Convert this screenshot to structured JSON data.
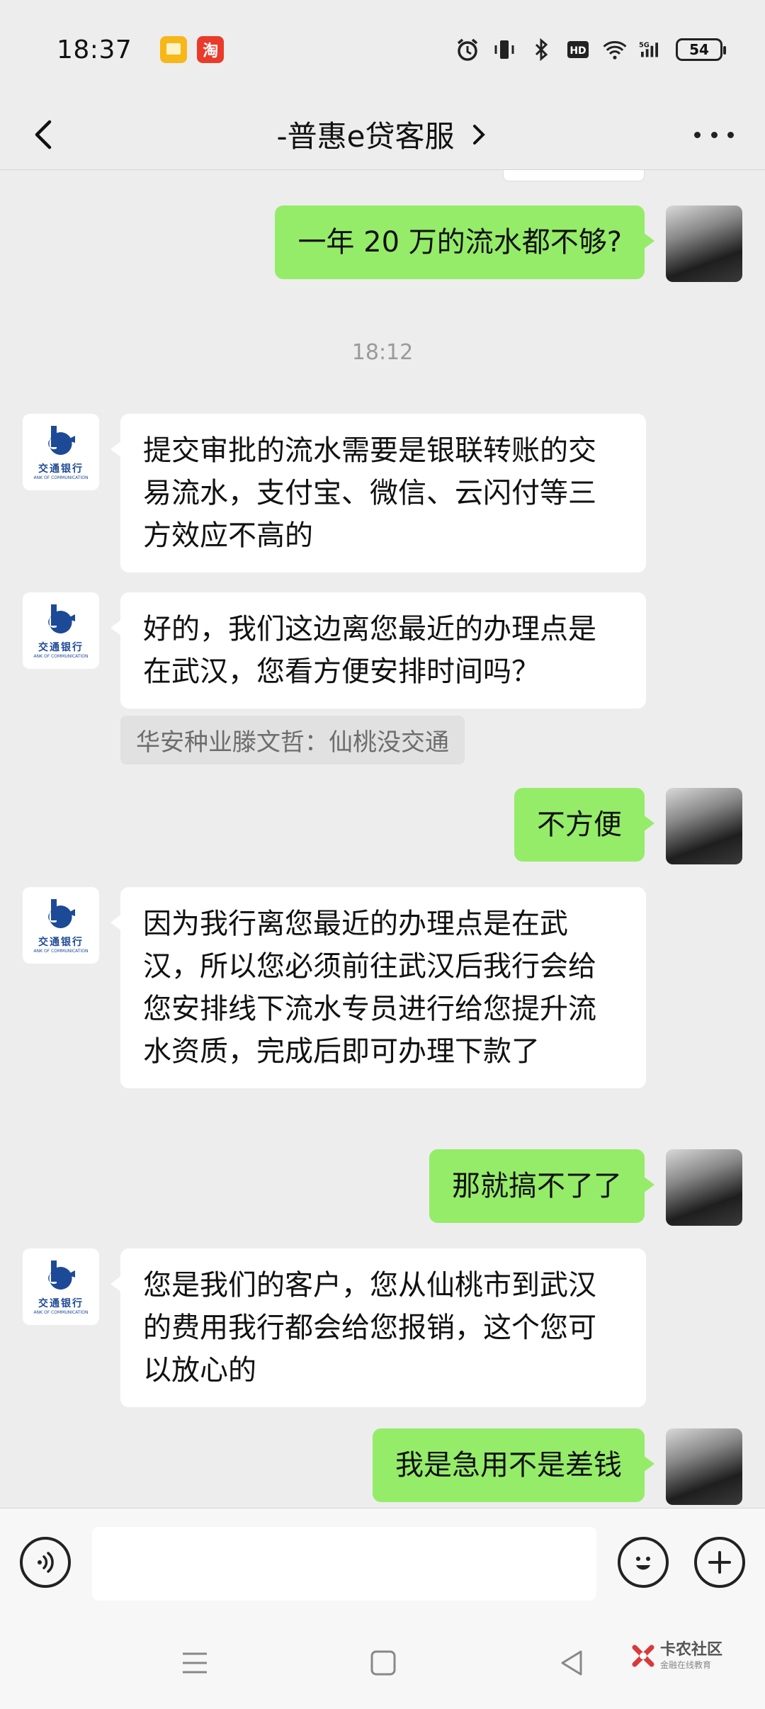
{
  "status_bar": {
    "time": "18:37",
    "notif_taobao": "淘",
    "battery": "54"
  },
  "header": {
    "title": "-普惠e贷客服"
  },
  "bank_logo": {
    "name_cn": "交通银行",
    "name_en": "ANK OF COMMUNICATION"
  },
  "messages": [
    {
      "from": "me",
      "text": "一年 20 万的流水都不够?"
    },
    {
      "type": "time",
      "text": "18:12"
    },
    {
      "from": "bank",
      "text": "提交审批的流水需要是银联转账的交易流水，支付宝、微信、云闪付等三方效应不高的"
    },
    {
      "from": "bank",
      "text": "好的，我们这边离您最近的办理点是在武汉，您看方便安排时间吗？"
    },
    {
      "type": "quote",
      "text": "华安种业滕文哲：仙桃没交通"
    },
    {
      "from": "me",
      "text": "不方便"
    },
    {
      "from": "bank",
      "text": "因为我行离您最近的办理点是在武汉，所以您必须前往武汉后我行会给您安排线下流水专员进行给您提升流水资质，完成后即可办理下款了"
    },
    {
      "from": "me",
      "text": "那就搞不了了"
    },
    {
      "from": "bank",
      "text": "您是我们的客户，您从仙桃市到武汉的费用我行都会给您报销，这个您可以放心的"
    },
    {
      "from": "me",
      "text": "我是急用不是差钱"
    }
  ],
  "input": {
    "value": ""
  },
  "watermark": {
    "main": "卡农社区",
    "sub": "金融在线教育"
  },
  "colors": {
    "outgoing": "#95ec69",
    "incoming": "#ffffff",
    "background": "#ededed",
    "bank_blue": "#1d4a97"
  }
}
